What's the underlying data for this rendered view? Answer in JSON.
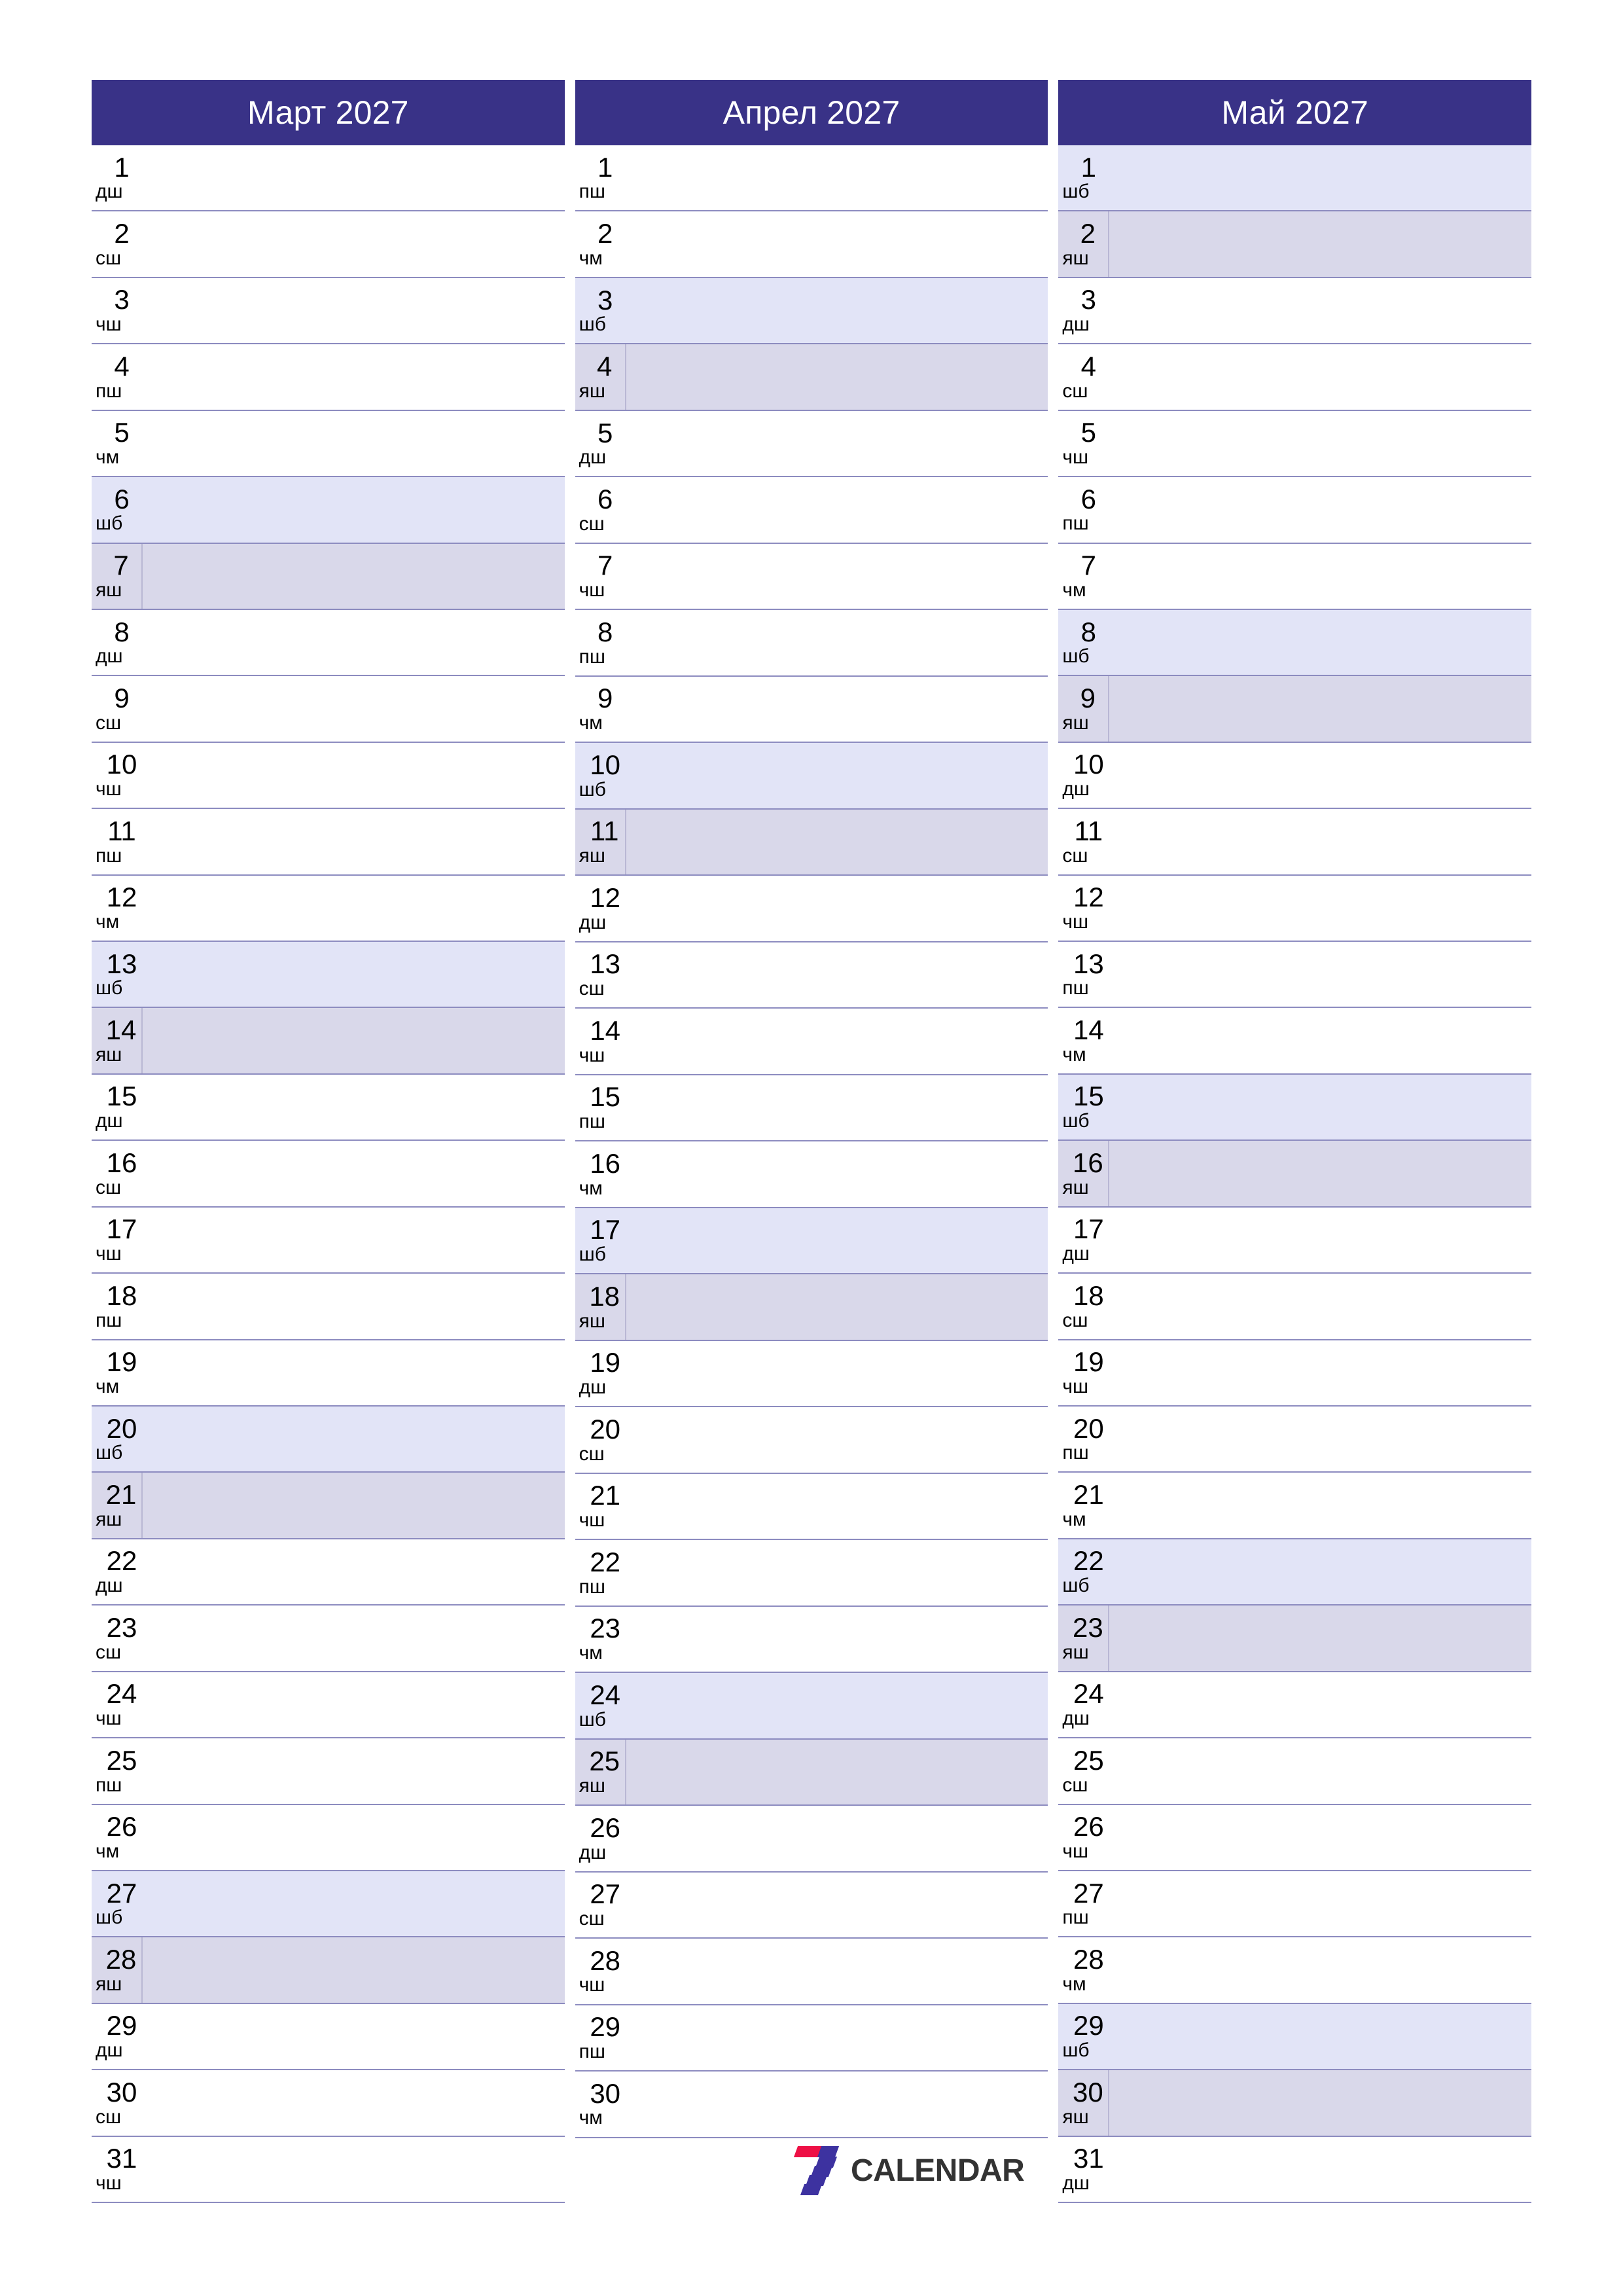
{
  "document": {
    "type": "three-month-planner",
    "year": "2027",
    "language": "uz-Cyrl"
  },
  "colors": {
    "header_background": "#393287",
    "header_text": "#ffffff",
    "row_divider": "#8d8cc0",
    "saturday_background": "#e2e4f7",
    "sunday_background": "#d9d8ea",
    "page_background": "#ffffff",
    "logo_red": "#ee1045",
    "logo_blue": "#3d32a0",
    "logo_text": "#333333"
  },
  "weekday_names": {
    "mon": "дш",
    "tue": "сш",
    "wed": "чш",
    "thu": "пш",
    "fri": "чм",
    "sat": "шб",
    "sun": "яш"
  },
  "logo": {
    "mark_name": "seven-calendar-logo",
    "text": "CALENDAR"
  },
  "months": [
    {
      "title": "Март 2027",
      "days": [
        {
          "num": "1",
          "wd": "дш",
          "type": "weekday"
        },
        {
          "num": "2",
          "wd": "сш",
          "type": "weekday"
        },
        {
          "num": "3",
          "wd": "чш",
          "type": "weekday"
        },
        {
          "num": "4",
          "wd": "пш",
          "type": "weekday"
        },
        {
          "num": "5",
          "wd": "чм",
          "type": "weekday"
        },
        {
          "num": "6",
          "wd": "шб",
          "type": "sat"
        },
        {
          "num": "7",
          "wd": "яш",
          "type": "sun"
        },
        {
          "num": "8",
          "wd": "дш",
          "type": "weekday"
        },
        {
          "num": "9",
          "wd": "сш",
          "type": "weekday"
        },
        {
          "num": "10",
          "wd": "чш",
          "type": "weekday"
        },
        {
          "num": "11",
          "wd": "пш",
          "type": "weekday"
        },
        {
          "num": "12",
          "wd": "чм",
          "type": "weekday"
        },
        {
          "num": "13",
          "wd": "шб",
          "type": "sat"
        },
        {
          "num": "14",
          "wd": "яш",
          "type": "sun"
        },
        {
          "num": "15",
          "wd": "дш",
          "type": "weekday"
        },
        {
          "num": "16",
          "wd": "сш",
          "type": "weekday"
        },
        {
          "num": "17",
          "wd": "чш",
          "type": "weekday"
        },
        {
          "num": "18",
          "wd": "пш",
          "type": "weekday"
        },
        {
          "num": "19",
          "wd": "чм",
          "type": "weekday"
        },
        {
          "num": "20",
          "wd": "шб",
          "type": "sat"
        },
        {
          "num": "21",
          "wd": "яш",
          "type": "sun"
        },
        {
          "num": "22",
          "wd": "дш",
          "type": "weekday"
        },
        {
          "num": "23",
          "wd": "сш",
          "type": "weekday"
        },
        {
          "num": "24",
          "wd": "чш",
          "type": "weekday"
        },
        {
          "num": "25",
          "wd": "пш",
          "type": "weekday"
        },
        {
          "num": "26",
          "wd": "чм",
          "type": "weekday"
        },
        {
          "num": "27",
          "wd": "шб",
          "type": "sat"
        },
        {
          "num": "28",
          "wd": "яш",
          "type": "sun"
        },
        {
          "num": "29",
          "wd": "дш",
          "type": "weekday"
        },
        {
          "num": "30",
          "wd": "сш",
          "type": "weekday"
        },
        {
          "num": "31",
          "wd": "чш",
          "type": "weekday"
        }
      ]
    },
    {
      "title": "Апрел 2027",
      "days": [
        {
          "num": "1",
          "wd": "пш",
          "type": "weekday"
        },
        {
          "num": "2",
          "wd": "чм",
          "type": "weekday"
        },
        {
          "num": "3",
          "wd": "шб",
          "type": "sat"
        },
        {
          "num": "4",
          "wd": "яш",
          "type": "sun"
        },
        {
          "num": "5",
          "wd": "дш",
          "type": "weekday"
        },
        {
          "num": "6",
          "wd": "сш",
          "type": "weekday"
        },
        {
          "num": "7",
          "wd": "чш",
          "type": "weekday"
        },
        {
          "num": "8",
          "wd": "пш",
          "type": "weekday"
        },
        {
          "num": "9",
          "wd": "чм",
          "type": "weekday"
        },
        {
          "num": "10",
          "wd": "шб",
          "type": "sat"
        },
        {
          "num": "11",
          "wd": "яш",
          "type": "sun"
        },
        {
          "num": "12",
          "wd": "дш",
          "type": "weekday"
        },
        {
          "num": "13",
          "wd": "сш",
          "type": "weekday"
        },
        {
          "num": "14",
          "wd": "чш",
          "type": "weekday"
        },
        {
          "num": "15",
          "wd": "пш",
          "type": "weekday"
        },
        {
          "num": "16",
          "wd": "чм",
          "type": "weekday"
        },
        {
          "num": "17",
          "wd": "шб",
          "type": "sat"
        },
        {
          "num": "18",
          "wd": "яш",
          "type": "sun"
        },
        {
          "num": "19",
          "wd": "дш",
          "type": "weekday"
        },
        {
          "num": "20",
          "wd": "сш",
          "type": "weekday"
        },
        {
          "num": "21",
          "wd": "чш",
          "type": "weekday"
        },
        {
          "num": "22",
          "wd": "пш",
          "type": "weekday"
        },
        {
          "num": "23",
          "wd": "чм",
          "type": "weekday"
        },
        {
          "num": "24",
          "wd": "шб",
          "type": "sat"
        },
        {
          "num": "25",
          "wd": "яш",
          "type": "sun"
        },
        {
          "num": "26",
          "wd": "дш",
          "type": "weekday"
        },
        {
          "num": "27",
          "wd": "сш",
          "type": "weekday"
        },
        {
          "num": "28",
          "wd": "чш",
          "type": "weekday"
        },
        {
          "num": "29",
          "wd": "пш",
          "type": "weekday"
        },
        {
          "num": "30",
          "wd": "чм",
          "type": "weekday"
        }
      ]
    },
    {
      "title": "Май 2027",
      "days": [
        {
          "num": "1",
          "wd": "шб",
          "type": "sat"
        },
        {
          "num": "2",
          "wd": "яш",
          "type": "sun"
        },
        {
          "num": "3",
          "wd": "дш",
          "type": "weekday"
        },
        {
          "num": "4",
          "wd": "сш",
          "type": "weekday"
        },
        {
          "num": "5",
          "wd": "чш",
          "type": "weekday"
        },
        {
          "num": "6",
          "wd": "пш",
          "type": "weekday"
        },
        {
          "num": "7",
          "wd": "чм",
          "type": "weekday"
        },
        {
          "num": "8",
          "wd": "шб",
          "type": "sat"
        },
        {
          "num": "9",
          "wd": "яш",
          "type": "sun"
        },
        {
          "num": "10",
          "wd": "дш",
          "type": "weekday"
        },
        {
          "num": "11",
          "wd": "сш",
          "type": "weekday"
        },
        {
          "num": "12",
          "wd": "чш",
          "type": "weekday"
        },
        {
          "num": "13",
          "wd": "пш",
          "type": "weekday"
        },
        {
          "num": "14",
          "wd": "чм",
          "type": "weekday"
        },
        {
          "num": "15",
          "wd": "шб",
          "type": "sat"
        },
        {
          "num": "16",
          "wd": "яш",
          "type": "sun"
        },
        {
          "num": "17",
          "wd": "дш",
          "type": "weekday"
        },
        {
          "num": "18",
          "wd": "сш",
          "type": "weekday"
        },
        {
          "num": "19",
          "wd": "чш",
          "type": "weekday"
        },
        {
          "num": "20",
          "wd": "пш",
          "type": "weekday"
        },
        {
          "num": "21",
          "wd": "чм",
          "type": "weekday"
        },
        {
          "num": "22",
          "wd": "шб",
          "type": "sat"
        },
        {
          "num": "23",
          "wd": "яш",
          "type": "sun"
        },
        {
          "num": "24",
          "wd": "дш",
          "type": "weekday"
        },
        {
          "num": "25",
          "wd": "сш",
          "type": "weekday"
        },
        {
          "num": "26",
          "wd": "чш",
          "type": "weekday"
        },
        {
          "num": "27",
          "wd": "пш",
          "type": "weekday"
        },
        {
          "num": "28",
          "wd": "чм",
          "type": "weekday"
        },
        {
          "num": "29",
          "wd": "шб",
          "type": "sat"
        },
        {
          "num": "30",
          "wd": "яш",
          "type": "sun"
        },
        {
          "num": "31",
          "wd": "дш",
          "type": "weekday"
        }
      ]
    }
  ]
}
